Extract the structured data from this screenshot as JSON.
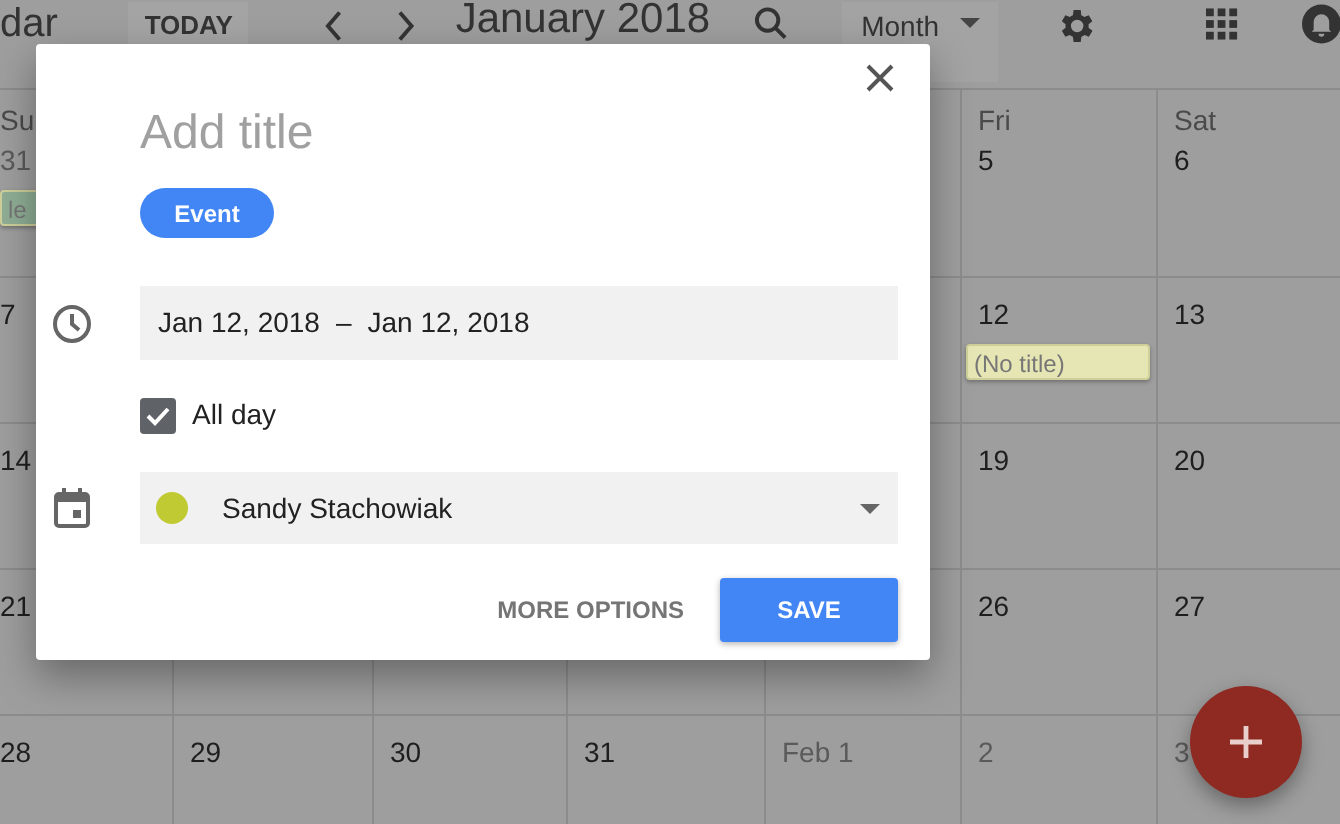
{
  "top_bar": {
    "app_title": "dar",
    "today_button": "TODAY",
    "month_label": "January 2018",
    "view_select": "Month"
  },
  "weeks": [
    {
      "cells": [
        {
          "header": "Su",
          "date": "31",
          "other_month": true,
          "event": {
            "label": "le",
            "color": "#8fae95"
          }
        },
        {},
        {},
        {},
        {},
        {
          "header": "Fri",
          "date": "5",
          "other_month": false
        },
        {
          "header": "Sat",
          "date": "6",
          "other_month": false
        }
      ]
    },
    {
      "cells": [
        {
          "date": "7",
          "other_month": false
        },
        {},
        {},
        {},
        {},
        {
          "date": "12",
          "other_month": false,
          "event": {
            "label": "(No title)",
            "color": "#e6e6b4"
          }
        },
        {
          "date": "13",
          "other_month": false
        }
      ]
    },
    {
      "cells": [
        {
          "date": "14",
          "other_month": false
        },
        {},
        {},
        {},
        {},
        {
          "date": "19",
          "other_month": false
        },
        {
          "date": "20",
          "other_month": false
        }
      ]
    },
    {
      "cells": [
        {
          "date": "21",
          "other_month": false
        },
        {},
        {},
        {},
        {},
        {
          "date": "26",
          "other_month": false
        },
        {
          "date": "27",
          "other_month": false
        }
      ]
    },
    {
      "cells": [
        {
          "date": "28",
          "other_month": false
        },
        {
          "date": "29",
          "other_month": false
        },
        {
          "date": "30",
          "other_month": false
        },
        {
          "date": "31",
          "other_month": false
        },
        {
          "date": "Feb 1",
          "other_month": true
        },
        {
          "date": "2",
          "other_month": true
        },
        {
          "date": "3",
          "other_month": true
        }
      ]
    }
  ],
  "dialog": {
    "title_placeholder": "Add title",
    "type_chip": "Event",
    "date_start": "Jan 12, 2018",
    "date_separator": "–",
    "date_end": "Jan 12, 2018",
    "all_day": {
      "label": "All day",
      "checked": true
    },
    "calendar": {
      "value": "Sandy Stachowiak",
      "color": "#c0ca33"
    },
    "buttons": [
      {
        "label": "MORE OPTIONS",
        "kind": "text"
      },
      {
        "label": "SAVE",
        "kind": "primary"
      }
    ]
  }
}
